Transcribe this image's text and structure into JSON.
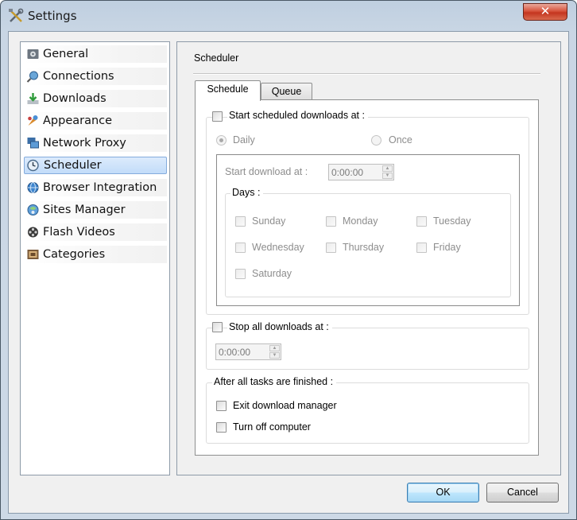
{
  "window": {
    "title": "Settings",
    "close_glyph": "✕"
  },
  "sidebar": {
    "items": [
      {
        "label": "General",
        "icon": "general-icon"
      },
      {
        "label": "Connections",
        "icon": "connections-icon"
      },
      {
        "label": "Downloads",
        "icon": "downloads-icon"
      },
      {
        "label": "Appearance",
        "icon": "appearance-icon"
      },
      {
        "label": "Network Proxy",
        "icon": "network-proxy-icon"
      },
      {
        "label": "Scheduler",
        "icon": "scheduler-icon",
        "selected": true
      },
      {
        "label": "Browser Integration",
        "icon": "browser-integration-icon"
      },
      {
        "label": "Sites Manager",
        "icon": "sites-manager-icon"
      },
      {
        "label": "Flash Videos",
        "icon": "flash-videos-icon"
      },
      {
        "label": "Categories",
        "icon": "categories-icon"
      }
    ]
  },
  "scheduler": {
    "group_title": "Scheduler",
    "tabs": [
      {
        "label": "Schedule",
        "active": true
      },
      {
        "label": "Queue",
        "active": false
      }
    ],
    "start": {
      "label": "Start scheduled downloads at :",
      "checked": false,
      "mode_daily": "Daily",
      "mode_once": "Once",
      "selected_mode": "Daily",
      "time_label": "Start download at :",
      "time_value": "0:00:00",
      "days_title": "Days :",
      "days": [
        "Sunday",
        "Monday",
        "Tuesday",
        "Wednesday",
        "Thursday",
        "Friday",
        "Saturday"
      ]
    },
    "stop": {
      "label": "Stop all downloads at :",
      "checked": false,
      "time_value": "0:00:00"
    },
    "after": {
      "title": "After all tasks are finished :",
      "exit_label": "Exit download manager",
      "shutdown_label": "Turn off computer"
    }
  },
  "footer": {
    "ok_label": "OK",
    "cancel_label": "Cancel"
  }
}
